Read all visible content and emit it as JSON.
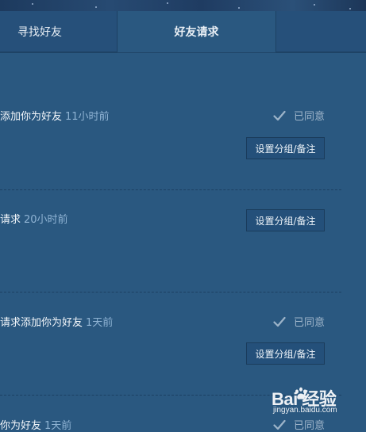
{
  "tabs": [
    {
      "label": "寻找好友",
      "active": false
    },
    {
      "label": "好友请求",
      "active": true
    },
    {
      "label": "",
      "active": false
    }
  ],
  "requests": [
    {
      "text": "添加你为好友",
      "time": "11小时前",
      "status": "已同意",
      "action": "设置分组/备注"
    },
    {
      "text": "请求",
      "time": "20小时前",
      "status": "",
      "action": "设置分组/备注"
    },
    {
      "text": "请求添加你为好友",
      "time": "1天前",
      "status": "已同意",
      "action": "设置分组/备注"
    },
    {
      "text": "你为好友",
      "time": "1天前",
      "status": "已同意",
      "action": ""
    }
  ],
  "watermark": {
    "logo": "Bai 经验",
    "url": "jingyan.baidu.com"
  },
  "colors": {
    "background": "#2a5880",
    "tab_inactive": "#26507a",
    "time_text": "#8fb3d3",
    "status_text": "#9db4c9"
  },
  "icons": {
    "check": "check-icon",
    "paw": "baidu-paw-icon"
  }
}
